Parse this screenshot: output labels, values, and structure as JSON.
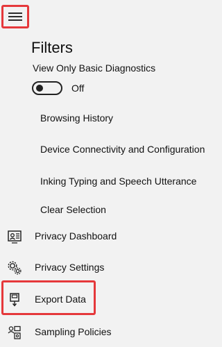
{
  "filters": {
    "title": "Filters",
    "basic_diagnostics_label": "View Only Basic Diagnostics",
    "toggle_state_text": "Off",
    "items": [
      {
        "label": "Browsing History"
      },
      {
        "label": "Device Connectivity and Configuration"
      },
      {
        "label": "Inking Typing and Speech Utterance"
      },
      {
        "label": "Clear Selection"
      }
    ]
  },
  "nav": {
    "items": [
      {
        "label": "Privacy Dashboard",
        "icon": "privacy-dashboard-icon"
      },
      {
        "label": "Privacy Settings",
        "icon": "gear-icon"
      },
      {
        "label": "Export Data",
        "icon": "export-data-icon"
      },
      {
        "label": "Sampling Policies",
        "icon": "sampling-policies-icon"
      }
    ]
  },
  "colors": {
    "background": "#f2f2f2",
    "highlight": "#e5383b",
    "text": "#111111"
  }
}
